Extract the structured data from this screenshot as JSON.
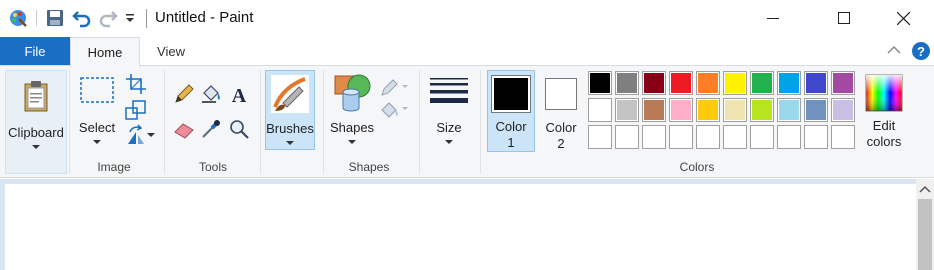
{
  "window": {
    "title": "Untitled - Paint"
  },
  "tabs": {
    "file": "File",
    "home": "Home",
    "view": "View"
  },
  "ribbon": {
    "clipboard": {
      "label": "Clipboard"
    },
    "image": {
      "select_label": "Select",
      "group_label": "Image"
    },
    "tools": {
      "group_label": "Tools"
    },
    "brushes": {
      "label": "Brushes"
    },
    "shapes": {
      "label": "Shapes",
      "group_label": "Shapes"
    },
    "size": {
      "label": "Size"
    },
    "colors": {
      "color1_label": "Color 1",
      "color1_line1": "Color",
      "color1_line2": "1",
      "color2_line1": "Color",
      "color2_line2": "2",
      "edit_line1": "Edit",
      "edit_line2": "colors",
      "group_label": "Colors",
      "color1_value": "#000000",
      "color2_value": "#ffffff",
      "palette": [
        "#000000",
        "#7f7f7f",
        "#880015",
        "#ed1c24",
        "#ff7f27",
        "#fff200",
        "#22b14c",
        "#00a2e8",
        "#3f48cc",
        "#a349a4",
        "#ffffff",
        "#c3c3c3",
        "#b97a57",
        "#ffaec9",
        "#ffc90e",
        "#efe4b0",
        "#b5e61d",
        "#99d9ea",
        "#7092be",
        "#c8bfe7",
        "",
        "",
        "",
        "",
        "",
        "",
        "",
        "",
        "",
        ""
      ]
    }
  },
  "accent": "#1a6fc4"
}
